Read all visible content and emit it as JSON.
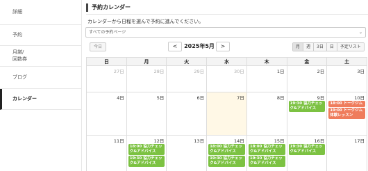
{
  "sidebar": {
    "items": [
      {
        "label": "詳細"
      },
      {
        "label": "予約"
      },
      {
        "label": "月謝/\n回数券"
      },
      {
        "label": "ブログ"
      },
      {
        "label": "カレンダー"
      }
    ]
  },
  "header": {
    "title": "予約カレンダー",
    "subtitle": "カレンダーから日程を選んで予約に進んでください。"
  },
  "filter": {
    "selected": "すべての予約ページ"
  },
  "toolbar": {
    "today_label": "今日",
    "prev_label": "<",
    "next_label": ">",
    "month_label": "2025年5月",
    "views": [
      "月",
      "週",
      "3日",
      "日",
      "予定リスト"
    ]
  },
  "calendar": {
    "weekdays": [
      "日",
      "月",
      "火",
      "水",
      "木",
      "金",
      "土"
    ],
    "weeks": [
      [
        {
          "day": "27日",
          "other": true,
          "events": []
        },
        {
          "day": "28日",
          "other": true,
          "events": []
        },
        {
          "day": "29日",
          "other": true,
          "events": []
        },
        {
          "day": "30日",
          "other": true,
          "events": []
        },
        {
          "day": "1日",
          "events": []
        },
        {
          "day": "2日",
          "events": []
        },
        {
          "day": "3日",
          "events": []
        }
      ],
      [
        {
          "day": "4日",
          "events": []
        },
        {
          "day": "5日",
          "events": []
        },
        {
          "day": "6日",
          "events": []
        },
        {
          "day": "7日",
          "today": true,
          "events": []
        },
        {
          "day": "8日",
          "events": []
        },
        {
          "day": "9日",
          "events": [
            {
              "text": "19:30 協力チェック&アドバイス",
              "color": "green"
            }
          ]
        },
        {
          "day": "10日",
          "events": [
            {
              "text": "18:00 トークジム",
              "color": "orange"
            },
            {
              "text": "19:00 トークジム体験レッスン",
              "color": "orange"
            }
          ]
        }
      ],
      [
        {
          "day": "11日",
          "events": []
        },
        {
          "day": "12日",
          "events": [
            {
              "text": "18:00 協力チェック&アドバイス",
              "color": "green"
            },
            {
              "text": "19:30 協力チェック&アドバイス",
              "color": "green"
            }
          ]
        },
        {
          "day": "13日",
          "events": []
        },
        {
          "day": "14日",
          "events": [
            {
              "text": "18:00 協力チェック&アドバイス",
              "color": "green"
            },
            {
              "text": "19:30 協力チェック&アドバイス",
              "color": "green"
            }
          ]
        },
        {
          "day": "15日",
          "events": [
            {
              "text": "18:00 協力チェック&アドバイス",
              "color": "green"
            },
            {
              "text": "19:30 協力チェック&アドバイス",
              "color": "green"
            }
          ]
        },
        {
          "day": "16日",
          "events": [
            {
              "text": "19:30 協力チェック&アドバイス",
              "color": "green"
            }
          ]
        },
        {
          "day": "17日",
          "events": []
        }
      ]
    ]
  },
  "colors": {
    "today_bg": "#fff8e6",
    "event_green": "#7cc242",
    "event_orange": "#ef7c5c"
  }
}
